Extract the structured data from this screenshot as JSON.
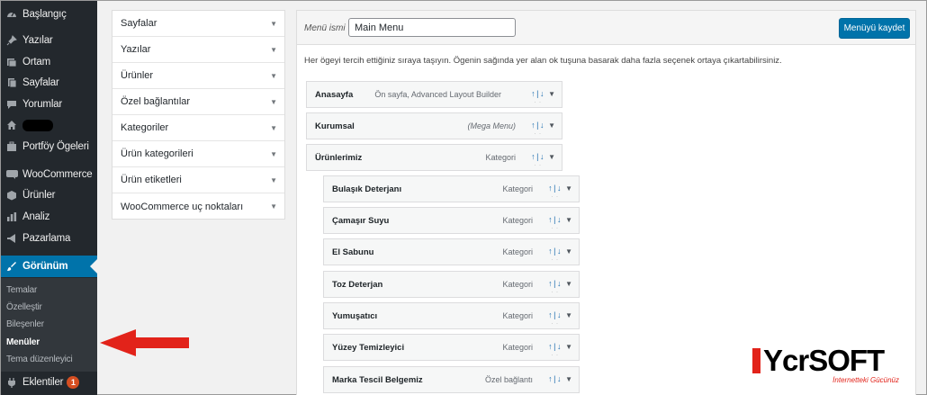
{
  "sidebar": {
    "items": [
      {
        "label": "Başlangıç",
        "icon": "dashboard-icon"
      },
      {
        "label": "Yazılar",
        "icon": "pin-icon"
      },
      {
        "label": "Ortam",
        "icon": "media-icon"
      },
      {
        "label": "Sayfalar",
        "icon": "pages-icon"
      },
      {
        "label": "Yorumlar",
        "icon": "comments-icon"
      },
      {
        "label": "",
        "icon": "home-icon"
      },
      {
        "label": "Portföy Ögeleri",
        "icon": "portfolio-icon"
      },
      {
        "label": "WooCommerce",
        "icon": "woocommerce-icon"
      },
      {
        "label": "Ürünler",
        "icon": "products-icon"
      },
      {
        "label": "Analiz",
        "icon": "analytics-icon"
      },
      {
        "label": "Pazarlama",
        "icon": "marketing-icon"
      },
      {
        "label": "Görünüm",
        "icon": "appearance-icon"
      },
      {
        "label": "Eklentiler",
        "icon": "plugins-icon",
        "badge": "1"
      }
    ],
    "submenu": [
      "Temalar",
      "Özelleştir",
      "Bileşenler",
      "Menüler",
      "Tema düzenleyici"
    ]
  },
  "accordion": [
    "Sayfalar",
    "Yazılar",
    "Ürünler",
    "Özel bağlantılar",
    "Kategoriler",
    "Ürün kategorileri",
    "Ürün etiketleri",
    "WooCommerce uç noktaları"
  ],
  "editor": {
    "menu_name_label": "Menü ismi",
    "menu_name_value": "Main Menu",
    "save_label": "Menüyü kaydet",
    "instructions": "Her ögeyi tercih ettiğiniz sıraya taşıyın. Ögenin sağında yer alan ok tuşuna basarak daha fazla seçenek ortaya çıkartabilirsiniz.",
    "move_up": "↑",
    "move_sep": "|",
    "move_down": "↓",
    "items": [
      {
        "title": "Anasayfa",
        "type": "Ön sayfa, Advanced Layout Builder"
      },
      {
        "title": "Kurumsal",
        "type": "(Mega Menu)"
      },
      {
        "title": "Ürünlerimiz",
        "type": "Kategori"
      },
      {
        "title": "Bulaşık Deterjanı",
        "type": "Kategori"
      },
      {
        "title": "Çamaşır Suyu",
        "type": "Kategori"
      },
      {
        "title": "El Sabunu",
        "type": "Kategori"
      },
      {
        "title": "Toz Deterjan",
        "type": "Kategori"
      },
      {
        "title": "Yumuşatıcı",
        "type": "Kategori"
      },
      {
        "title": "Yüzey Temizleyici",
        "type": "Kategori"
      },
      {
        "title": "Marka Tescil Belgemiz",
        "type": "Özel bağlantı"
      }
    ]
  },
  "logo": {
    "text": "YcrSOFT",
    "tagline": "İnternetteki Gücünüz"
  },
  "colors": {
    "sidebar_bg": "#23282d",
    "active_bg": "#0073aa",
    "arrow": "#e2231a"
  }
}
